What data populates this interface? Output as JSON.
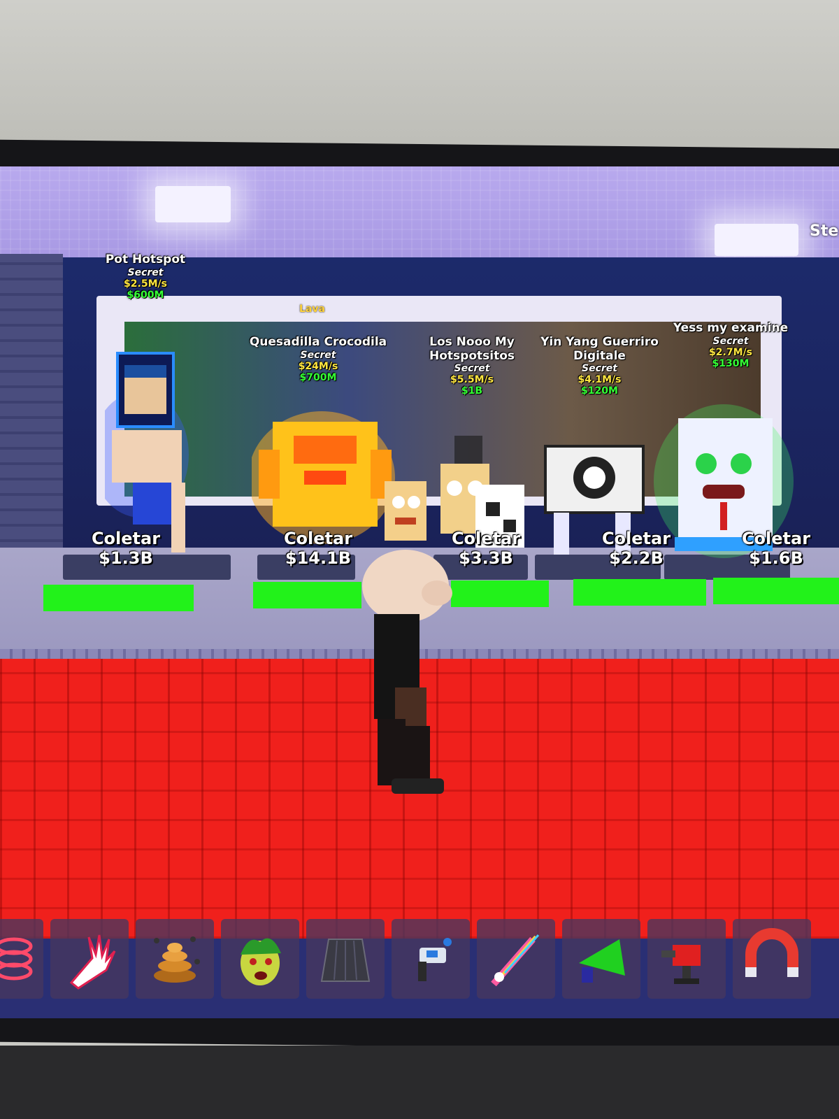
{
  "top_right_label": "Ste",
  "billboard_tag": "Lava",
  "pets": [
    {
      "name": "Pot Hotspot",
      "rarity": "Secret",
      "per_sec": "$2.5M/s",
      "price": "$600M"
    },
    {
      "name": "Quesadilla Crocodila",
      "rarity": "Secret",
      "per_sec": "$24M/s",
      "price": "$700M"
    },
    {
      "name": "Los Nooo My Hotspotsitos",
      "rarity": "Secret",
      "per_sec": "$5.5M/s",
      "price": "$1B"
    },
    {
      "name": "Yin Yang Guerriro Digitale",
      "rarity": "Secret",
      "per_sec": "$4.1M/s",
      "price": "$120M"
    },
    {
      "name": "Yess my examine",
      "rarity": "Secret",
      "per_sec": "$2.7M/s",
      "price": "$130M"
    }
  ],
  "collectors": [
    {
      "label": "Coletar",
      "amount": "$1.3B"
    },
    {
      "label": "Coletar",
      "amount": "$14.1B"
    },
    {
      "label": "Coletar",
      "amount": "$3.3B"
    },
    {
      "label": "Coletar",
      "amount": "$2.2B"
    },
    {
      "label": "Coletar",
      "amount": "$1.6B"
    }
  ],
  "hotbar": [
    {
      "icon": "spring-coil-icon",
      "color": "#ff4a6a"
    },
    {
      "icon": "glove-icon",
      "color": "#ffffff"
    },
    {
      "icon": "beehive-icon",
      "color": "#d68a2a"
    },
    {
      "icon": "medusa-head-icon",
      "color": "#c8d640"
    },
    {
      "icon": "dark-cape-icon",
      "color": "#3a3a44"
    },
    {
      "icon": "grapple-gun-icon",
      "color": "#2a7adf"
    },
    {
      "icon": "rainbow-sword-icon",
      "color": "#ff5aa0"
    },
    {
      "icon": "green-megaphone-icon",
      "color": "#20d020"
    },
    {
      "icon": "red-turret-icon",
      "color": "#e02020"
    },
    {
      "icon": "magnet-icon",
      "color": "#e83a30"
    }
  ]
}
